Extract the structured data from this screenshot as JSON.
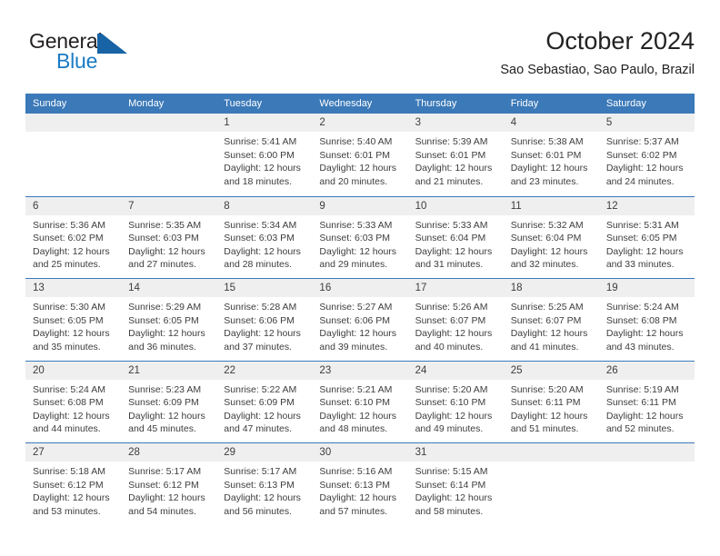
{
  "brand": {
    "name_top": "General",
    "name_bottom": "Blue",
    "logo_icon": "blue-triangle-logo",
    "color_dark": "#231f20",
    "color_blue": "#1a7bc4"
  },
  "header": {
    "title": "October 2024",
    "subtitle": "Sao Sebastiao, Sao Paulo, Brazil"
  },
  "theme": {
    "header_blue": "#3b79b8",
    "day_band_gray": "#efeff0",
    "text": "#3d3d3d"
  },
  "calendar": {
    "weekdays": [
      "Sunday",
      "Monday",
      "Tuesday",
      "Wednesday",
      "Thursday",
      "Friday",
      "Saturday"
    ],
    "weeks": [
      [
        {
          "day": "",
          "lines": []
        },
        {
          "day": "",
          "lines": []
        },
        {
          "day": "1",
          "lines": [
            "Sunrise: 5:41 AM",
            "Sunset: 6:00 PM",
            "Daylight: 12 hours",
            "and 18 minutes."
          ]
        },
        {
          "day": "2",
          "lines": [
            "Sunrise: 5:40 AM",
            "Sunset: 6:01 PM",
            "Daylight: 12 hours",
            "and 20 minutes."
          ]
        },
        {
          "day": "3",
          "lines": [
            "Sunrise: 5:39 AM",
            "Sunset: 6:01 PM",
            "Daylight: 12 hours",
            "and 21 minutes."
          ]
        },
        {
          "day": "4",
          "lines": [
            "Sunrise: 5:38 AM",
            "Sunset: 6:01 PM",
            "Daylight: 12 hours",
            "and 23 minutes."
          ]
        },
        {
          "day": "5",
          "lines": [
            "Sunrise: 5:37 AM",
            "Sunset: 6:02 PM",
            "Daylight: 12 hours",
            "and 24 minutes."
          ]
        }
      ],
      [
        {
          "day": "6",
          "lines": [
            "Sunrise: 5:36 AM",
            "Sunset: 6:02 PM",
            "Daylight: 12 hours",
            "and 25 minutes."
          ]
        },
        {
          "day": "7",
          "lines": [
            "Sunrise: 5:35 AM",
            "Sunset: 6:03 PM",
            "Daylight: 12 hours",
            "and 27 minutes."
          ]
        },
        {
          "day": "8",
          "lines": [
            "Sunrise: 5:34 AM",
            "Sunset: 6:03 PM",
            "Daylight: 12 hours",
            "and 28 minutes."
          ]
        },
        {
          "day": "9",
          "lines": [
            "Sunrise: 5:33 AM",
            "Sunset: 6:03 PM",
            "Daylight: 12 hours",
            "and 29 minutes."
          ]
        },
        {
          "day": "10",
          "lines": [
            "Sunrise: 5:33 AM",
            "Sunset: 6:04 PM",
            "Daylight: 12 hours",
            "and 31 minutes."
          ]
        },
        {
          "day": "11",
          "lines": [
            "Sunrise: 5:32 AM",
            "Sunset: 6:04 PM",
            "Daylight: 12 hours",
            "and 32 minutes."
          ]
        },
        {
          "day": "12",
          "lines": [
            "Sunrise: 5:31 AM",
            "Sunset: 6:05 PM",
            "Daylight: 12 hours",
            "and 33 minutes."
          ]
        }
      ],
      [
        {
          "day": "13",
          "lines": [
            "Sunrise: 5:30 AM",
            "Sunset: 6:05 PM",
            "Daylight: 12 hours",
            "and 35 minutes."
          ]
        },
        {
          "day": "14",
          "lines": [
            "Sunrise: 5:29 AM",
            "Sunset: 6:05 PM",
            "Daylight: 12 hours",
            "and 36 minutes."
          ]
        },
        {
          "day": "15",
          "lines": [
            "Sunrise: 5:28 AM",
            "Sunset: 6:06 PM",
            "Daylight: 12 hours",
            "and 37 minutes."
          ]
        },
        {
          "day": "16",
          "lines": [
            "Sunrise: 5:27 AM",
            "Sunset: 6:06 PM",
            "Daylight: 12 hours",
            "and 39 minutes."
          ]
        },
        {
          "day": "17",
          "lines": [
            "Sunrise: 5:26 AM",
            "Sunset: 6:07 PM",
            "Daylight: 12 hours",
            "and 40 minutes."
          ]
        },
        {
          "day": "18",
          "lines": [
            "Sunrise: 5:25 AM",
            "Sunset: 6:07 PM",
            "Daylight: 12 hours",
            "and 41 minutes."
          ]
        },
        {
          "day": "19",
          "lines": [
            "Sunrise: 5:24 AM",
            "Sunset: 6:08 PM",
            "Daylight: 12 hours",
            "and 43 minutes."
          ]
        }
      ],
      [
        {
          "day": "20",
          "lines": [
            "Sunrise: 5:24 AM",
            "Sunset: 6:08 PM",
            "Daylight: 12 hours",
            "and 44 minutes."
          ]
        },
        {
          "day": "21",
          "lines": [
            "Sunrise: 5:23 AM",
            "Sunset: 6:09 PM",
            "Daylight: 12 hours",
            "and 45 minutes."
          ]
        },
        {
          "day": "22",
          "lines": [
            "Sunrise: 5:22 AM",
            "Sunset: 6:09 PM",
            "Daylight: 12 hours",
            "and 47 minutes."
          ]
        },
        {
          "day": "23",
          "lines": [
            "Sunrise: 5:21 AM",
            "Sunset: 6:10 PM",
            "Daylight: 12 hours",
            "and 48 minutes."
          ]
        },
        {
          "day": "24",
          "lines": [
            "Sunrise: 5:20 AM",
            "Sunset: 6:10 PM",
            "Daylight: 12 hours",
            "and 49 minutes."
          ]
        },
        {
          "day": "25",
          "lines": [
            "Sunrise: 5:20 AM",
            "Sunset: 6:11 PM",
            "Daylight: 12 hours",
            "and 51 minutes."
          ]
        },
        {
          "day": "26",
          "lines": [
            "Sunrise: 5:19 AM",
            "Sunset: 6:11 PM",
            "Daylight: 12 hours",
            "and 52 minutes."
          ]
        }
      ],
      [
        {
          "day": "27",
          "lines": [
            "Sunrise: 5:18 AM",
            "Sunset: 6:12 PM",
            "Daylight: 12 hours",
            "and 53 minutes."
          ]
        },
        {
          "day": "28",
          "lines": [
            "Sunrise: 5:17 AM",
            "Sunset: 6:12 PM",
            "Daylight: 12 hours",
            "and 54 minutes."
          ]
        },
        {
          "day": "29",
          "lines": [
            "Sunrise: 5:17 AM",
            "Sunset: 6:13 PM",
            "Daylight: 12 hours",
            "and 56 minutes."
          ]
        },
        {
          "day": "30",
          "lines": [
            "Sunrise: 5:16 AM",
            "Sunset: 6:13 PM",
            "Daylight: 12 hours",
            "and 57 minutes."
          ]
        },
        {
          "day": "31",
          "lines": [
            "Sunrise: 5:15 AM",
            "Sunset: 6:14 PM",
            "Daylight: 12 hours",
            "and 58 minutes."
          ]
        },
        {
          "day": "",
          "lines": []
        },
        {
          "day": "",
          "lines": []
        }
      ]
    ]
  }
}
